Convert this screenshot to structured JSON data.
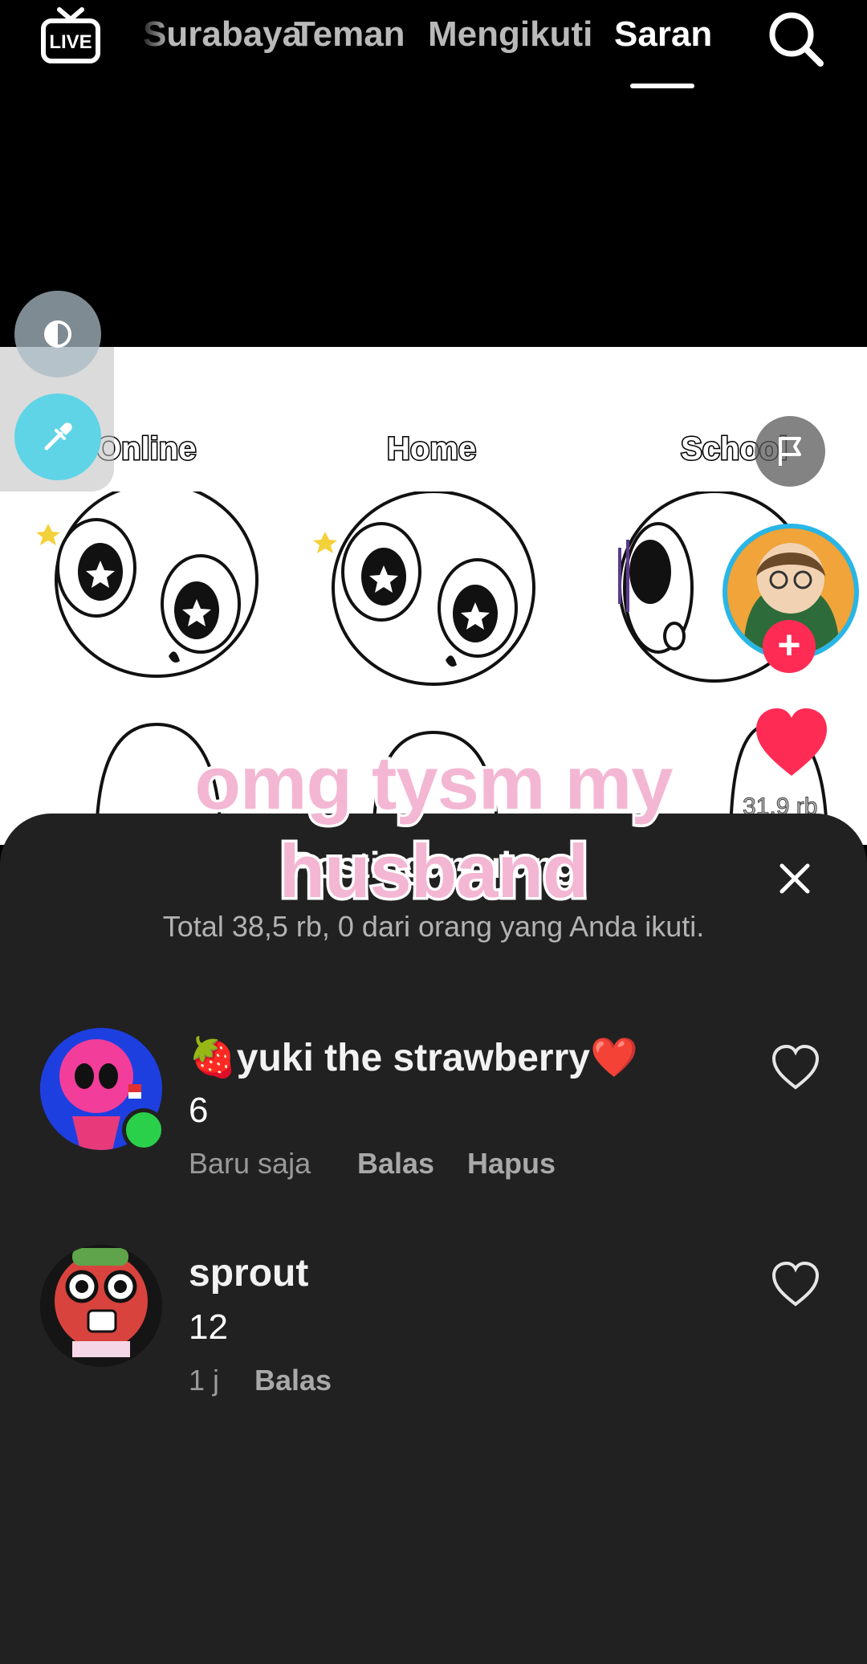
{
  "topbar": {
    "tabs": [
      {
        "label": "Surabaya",
        "active": false
      },
      {
        "label": "Teman",
        "active": false
      },
      {
        "label": "Mengikuti",
        "active": false
      },
      {
        "label": "Saran",
        "active": true
      }
    ],
    "live_label": "LIVE",
    "live_icon": "live-tv-icon",
    "search_icon": "search-icon"
  },
  "video": {
    "labels": [
      "Online",
      "Home",
      "School"
    ],
    "like_count": "31,9 rb",
    "overlay_caption": "omg tysm my husband",
    "tools": [
      "contrast-icon",
      "color-picker-icon",
      "flag-icon"
    ]
  },
  "sheet": {
    "title": "Postingan ulang",
    "subtitle": "Total 38,5 rb, 0 dari orang yang Anda ikuti.",
    "close_icon": "close-icon"
  },
  "comments": [
    {
      "user": "🍓yuki the strawberry❤️",
      "text": "6",
      "time": "Baru saja",
      "actions": [
        "Balas",
        "Hapus"
      ],
      "online": true
    },
    {
      "user": "sprout",
      "text": "12",
      "time": "1 j",
      "actions": [
        "Balas"
      ],
      "online": false
    }
  ],
  "colors": {
    "accent_red": "#fe2c55",
    "sheet_bg": "#212121",
    "overlay_text": "#f3b7d3",
    "online_green": "#2ad04a",
    "avatar_ring": "#28b6e6"
  }
}
